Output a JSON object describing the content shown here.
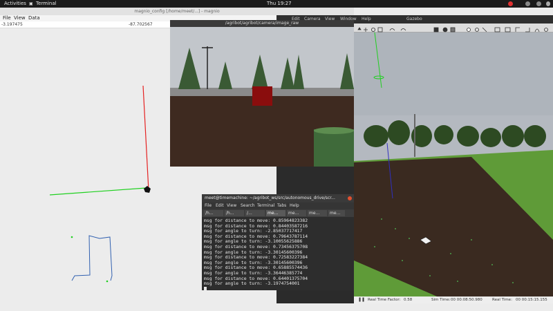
{
  "system_bar": {
    "activities": "Activities",
    "app_menu": "Terminal",
    "clock": "Thu 19:27",
    "power_icon": "power-icon"
  },
  "plot_window": {
    "title": "magnio_config [/home/meet/...] - magnio",
    "menu": [
      "File",
      "View",
      "Data"
    ],
    "coord_x": "-3.197475",
    "coord_y": "-87.702567"
  },
  "image_window": {
    "title": "/agribot/agribot/camera/image_raw"
  },
  "gazebo": {
    "title": "Gazebo",
    "menu": [
      "Edit",
      "Camera",
      "View",
      "Window",
      "Help"
    ],
    "real_time_factor_label": "Real Time Factor:",
    "real_time_factor": "0.58",
    "sim_time_label": "Sim Time:",
    "sim_time": "00 00:08:50.980",
    "real_time_label": "Real Time:",
    "real_time": "00 00:15:15.155"
  },
  "terminal": {
    "title": "meet@timemachine: ~/agribot_ws/src/autonomous_drive/scr...",
    "menu": [
      "File",
      "Edit",
      "View",
      "Search",
      "Terminal",
      "Tabs",
      "Help"
    ],
    "tabs": [
      "/h...",
      "/h...",
      "/...",
      "me...",
      "me...",
      "me...",
      "me..."
    ],
    "lines": [
      "msg for distance to move: 0.85964823382",
      "msg for distance to move: 0.84403587216",
      "msg for angle to turn: -2.85037717417",
      "msg for distance to move: 0.79643787114",
      "msg for angle to turn: -3.10055625886",
      "msg for distance to move: 0.73456375708",
      "msg for angle to turn: -3.30145600396",
      "msg for distance to move: 0.72583227384",
      "msg for angle to turn: -3.30145600396",
      "msg for distance to move: 0.65885574436",
      "msg for angle to turn: -3.36446385774",
      "msg for distance to move: 0.64401375704",
      "msg for angle to turn: -3.1974754001"
    ]
  }
}
